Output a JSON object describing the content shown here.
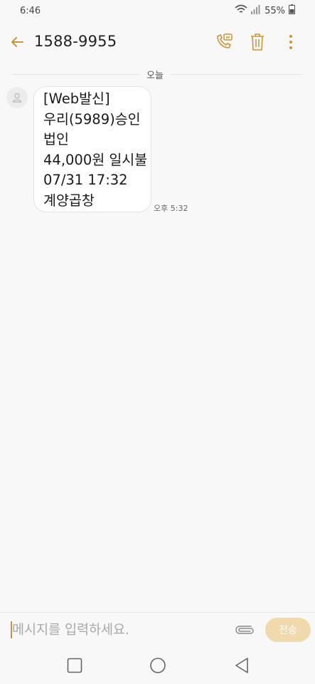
{
  "status_bar": {
    "time": "6:46",
    "battery": "55%"
  },
  "header": {
    "title": "1588-9955"
  },
  "conversation": {
    "date_divider": "오늘",
    "messages": [
      {
        "lines": [
          "[Web발신]",
          "우리(5989)승인",
          "법인",
          "44,000원 일시불",
          "07/31 17:32",
          "계양곱창"
        ],
        "time": "오후 5:32"
      }
    ]
  },
  "composer": {
    "placeholder": "메시지를 입력하세요.",
    "send_label": "전송"
  },
  "colors": {
    "accent": "#c8963e",
    "send_bg": "#efd9ad",
    "background": "#f8f8f8"
  }
}
